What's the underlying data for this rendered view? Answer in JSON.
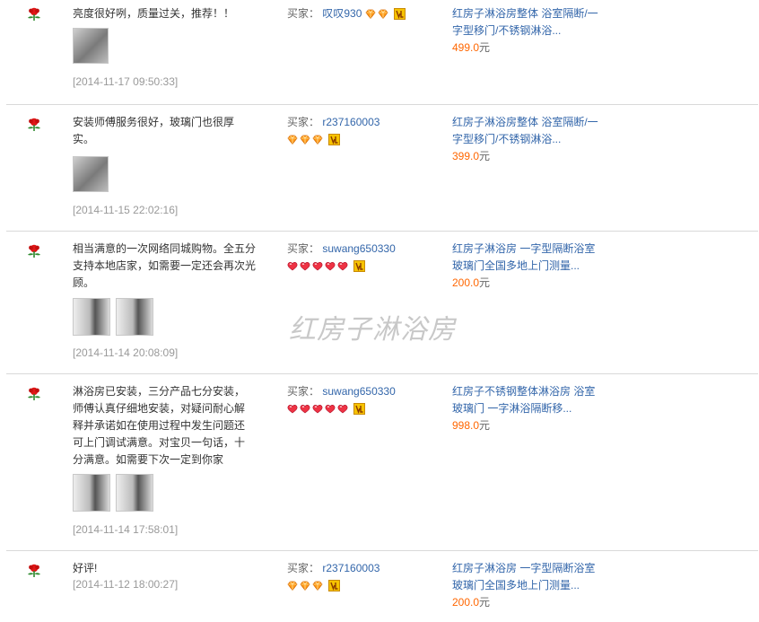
{
  "buyer_label": "买家：",
  "currency": "元",
  "watermark": "红房子淋浴房",
  "colors": {
    "link": "#3366aa",
    "price": "#ff6600",
    "date": "#999999",
    "gem": "#ff9900",
    "heart": "#ee3344"
  },
  "reviews": [
    {
      "comment": "亮度很好咧，质量过关，推荐！！",
      "date": "[2014-11-17 09:50:33]",
      "buyer": "叹叹930",
      "badge": "diamond-x2",
      "product": "红房子淋浴房整体 浴室隔断/一字型移门/不锈钢淋浴...",
      "price": "499.0"
    },
    {
      "comment": "安装师傅服务很好，玻璃门也很厚实。",
      "date": "[2014-11-15 22:02:16]",
      "buyer": "r237160003",
      "badge": "diamond-x3",
      "product": "红房子淋浴房整体 浴室隔断/一字型移门/不锈钢淋浴...",
      "price": "399.0"
    },
    {
      "comment": "相当满意的一次网络同城购物。全五分 支持本地店家，如需要一定还会再次光顾。",
      "date": "[2014-11-14 20:08:09]",
      "buyer": "suwang650330",
      "badge": "heart-x5",
      "product": "红房子淋浴房 一字型隔断浴室玻璃门全国多地上门测量...",
      "price": "200.0"
    },
    {
      "comment": "淋浴房已安装，三分产品七分安装，师傅认真仔细地安装，对疑问耐心解释并承诺如在使用过程中发生问题还可上门调试满意。对宝贝一句话，十分满意。如需要下次一定到你家",
      "date": "[2014-11-14 17:58:01]",
      "buyer": "suwang650330",
      "badge": "heart-x5",
      "product": "红房子不锈钢整体淋浴房 浴室玻璃门 一字淋浴隔断移...",
      "price": "998.0"
    },
    {
      "comment": "好评!",
      "date": "[2014-11-12 18:00:27]",
      "buyer": "r237160003",
      "badge": "diamond-x3",
      "product": "红房子淋浴房 一字型隔断浴室玻璃门全国多地上门测量...",
      "price": "200.0"
    }
  ]
}
